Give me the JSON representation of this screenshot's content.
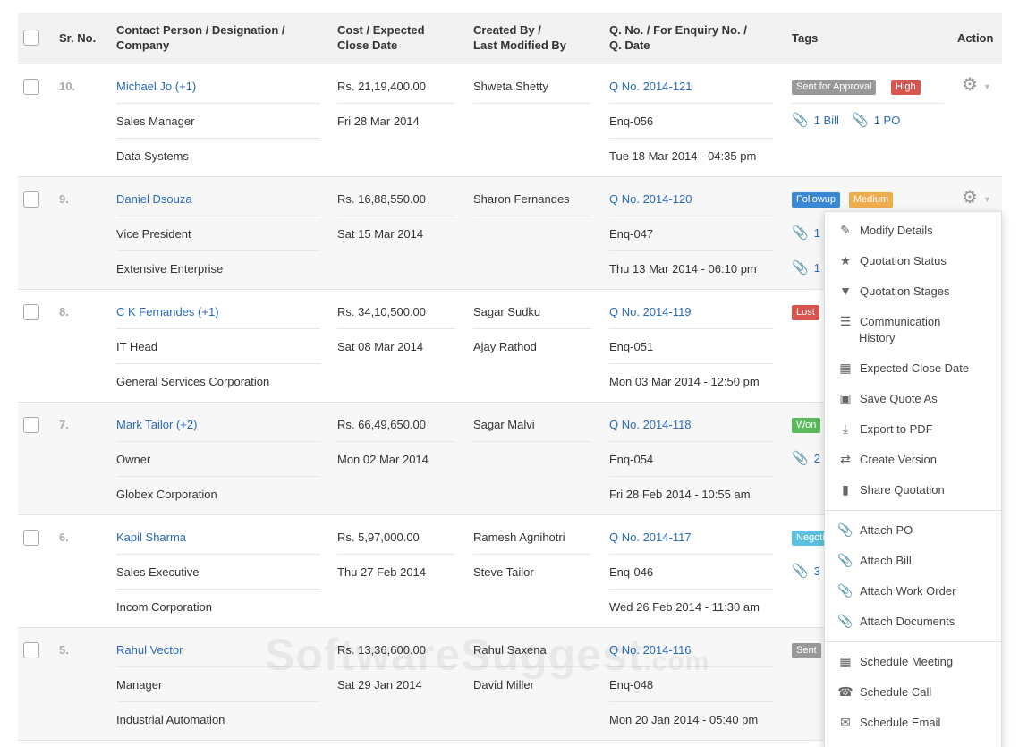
{
  "table": {
    "headers": {
      "srno": "Sr. No.",
      "contact_l1": "Contact Person / Designation /",
      "contact_l2": "Company",
      "cost_l1": "Cost / Expected",
      "cost_l2": "Close Date",
      "created_l1": "Created By /",
      "created_l2": "Last Modified By",
      "qno_l1": "Q. No. / For Enquiry No. /",
      "qno_l2": "Q. Date",
      "tags": "Tags",
      "action": "Action"
    },
    "rows": [
      {
        "srno": "10.",
        "contact": "Michael Jo (+1)",
        "designation": "Sales Manager",
        "company": "Data Systems",
        "cost": "Rs. 21,19,400.00",
        "close_date": "Fri 28 Mar 2014",
        "created_by": "Shweta Shetty",
        "modified_by": "",
        "qno": "Q No. 2014-121",
        "enq": "Enq-056",
        "qdate": "Tue 18 Mar 2014 - 04:35 pm",
        "tags": [
          "Sent for Approval",
          "High"
        ],
        "attach1": "1 Bill",
        "attach2": "1 PO"
      },
      {
        "srno": "9.",
        "contact": "Daniel Dsouza",
        "designation": "Vice President",
        "company": "Extensive Enterprise",
        "cost": "Rs. 16,88,550.00",
        "close_date": "Sat 15 Mar 2014",
        "created_by": "Sharon Fernandes",
        "modified_by": "",
        "qno": "Q No. 2014-120",
        "enq": "Enq-047",
        "qdate": "Thu 13 Mar 2014 - 06:10 pm",
        "tags": [
          "Followup",
          "Medium"
        ],
        "attach1": "1",
        "attach2": "1"
      },
      {
        "srno": "8.",
        "contact": "C K Fernandes (+1)",
        "designation": "IT Head",
        "company": "General Services Corporation",
        "cost": "Rs. 34,10,500.00",
        "close_date": "Sat 08 Mar 2014",
        "created_by": "Sagar Sudku",
        "modified_by": "Ajay Rathod",
        "qno": "Q No. 2014-119",
        "enq": "Enq-051",
        "qdate": "Mon 03 Mar 2014 - 12:50 pm",
        "tags": [
          "Lost"
        ]
      },
      {
        "srno": "7.",
        "contact": "Mark Tailor (+2)",
        "designation": "Owner",
        "company": "Globex Corporation",
        "cost": "Rs. 66,49,650.00",
        "close_date": "Mon 02 Mar 2014",
        "created_by": "Sagar Malvi",
        "modified_by": "",
        "qno": "Q No. 2014-118",
        "enq": "Enq-054",
        "qdate": "Fri 28 Feb 2014 - 10:55 am",
        "tags": [
          "Won"
        ],
        "attach1": "2"
      },
      {
        "srno": "6.",
        "contact": "Kapil Sharma",
        "designation": "Sales Executive",
        "company": "Incom Corporation",
        "cost": "Rs. 5,97,000.00",
        "close_date": "Thu 27 Feb 2014",
        "created_by": "Ramesh Agnihotri",
        "modified_by": "Steve Tailor",
        "qno": "Q No. 2014-117",
        "enq": "Enq-046",
        "qdate": "Wed 26 Feb 2014 - 11:30 am",
        "tags": [
          "Negoti"
        ],
        "attach1": "3"
      },
      {
        "srno": "5.",
        "contact": "Rahul Vector",
        "designation": "Manager",
        "company": "Industrial Automation",
        "cost": "Rs. 13,36,600.00",
        "close_date": "Sat 29 Jan 2014",
        "created_by": "Rahul Saxena",
        "modified_by": "David Miller",
        "qno": "Q No. 2014-116",
        "enq": "Enq-048",
        "qdate": "Mon 20 Jan 2014 - 05:40 pm",
        "tags": [
          "Sent"
        ]
      }
    ]
  },
  "action_menu": {
    "items": [
      {
        "label": "Modify Details",
        "icon": "edit-icon"
      },
      {
        "label": "Quotation Status",
        "icon": "star-icon"
      },
      {
        "label": "Quotation Stages",
        "icon": "filter-icon"
      },
      {
        "label": "Communication",
        "label2": "History",
        "icon": "list-icon"
      },
      {
        "label": "Expected Close Date",
        "icon": "calendar-icon"
      },
      {
        "label": "Save Quote As",
        "icon": "save-icon"
      },
      {
        "label": "Export to PDF",
        "icon": "download-icon"
      },
      {
        "label": "Create Version",
        "icon": "retweet-icon"
      },
      {
        "label": "Share Quotation",
        "icon": "file-icon"
      },
      {
        "label": "Attach PO",
        "icon": "paperclip-icon"
      },
      {
        "label": "Attach Bill",
        "icon": "paperclip-icon"
      },
      {
        "label": "Attach Work Order",
        "icon": "paperclip-icon"
      },
      {
        "label": "Attach Documents",
        "icon": "paperclip-icon"
      },
      {
        "label": "Schedule Meeting",
        "icon": "calendar-icon"
      },
      {
        "label": "Schedule Call",
        "icon": "phone-icon"
      },
      {
        "label": "Schedule Email",
        "icon": "envelope-icon"
      }
    ]
  },
  "watermark": {
    "main": "SoftwareSuggest",
    "suffix": ".com"
  },
  "colors": {
    "link": "#2a6ab8",
    "high": "#d9534f",
    "followup": "#3a87d4",
    "medium": "#f0ad4e",
    "won": "#5cb85c",
    "negotiation": "#5bc0de",
    "grey": "#999999"
  }
}
